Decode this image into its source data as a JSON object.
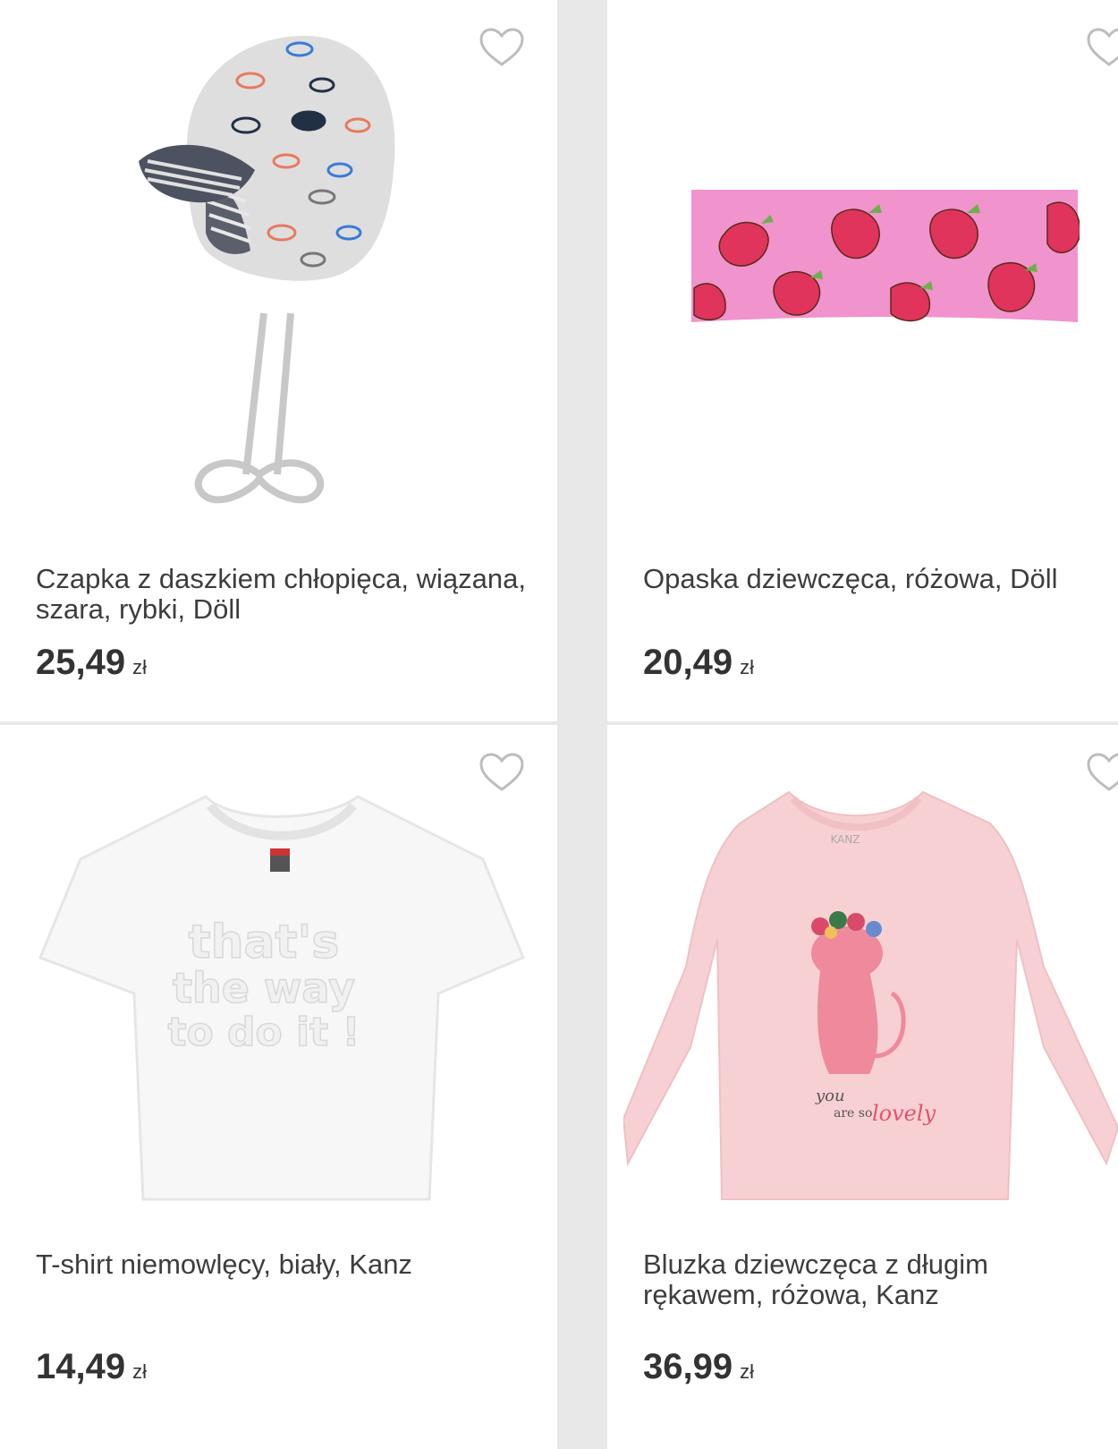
{
  "products": [
    {
      "name": "Czapka z daszkiem chłopięca, wiązana, szara, rybki, Döll",
      "price": "25,49",
      "currency": "zł",
      "image_icon": "baby-cap-fish-icon"
    },
    {
      "name": "Opaska dziewczęca, różowa, Döll",
      "price": "20,49",
      "currency": "zł",
      "image_icon": "strawberry-headband-icon"
    },
    {
      "name": "T-shirt niemowlęcy, biały, Kanz",
      "price": "14,49",
      "currency": "zł",
      "image_icon": "white-tshirt-icon",
      "print_text": [
        "that's",
        "the way",
        "to do it !"
      ]
    },
    {
      "name": "Bluzka dziewczęca z długim rękawem, różowa, Kanz",
      "price": "36,99",
      "currency": "zł",
      "image_icon": "pink-longsleeve-icon",
      "print_text": [
        "you",
        "are so",
        "lovely"
      ],
      "label_text": "KANZ"
    }
  ],
  "colors": {
    "background": "#e8e8e8",
    "card": "#ffffff",
    "text": "#3d3d3d",
    "heart_outline": "#bdbdbd"
  }
}
